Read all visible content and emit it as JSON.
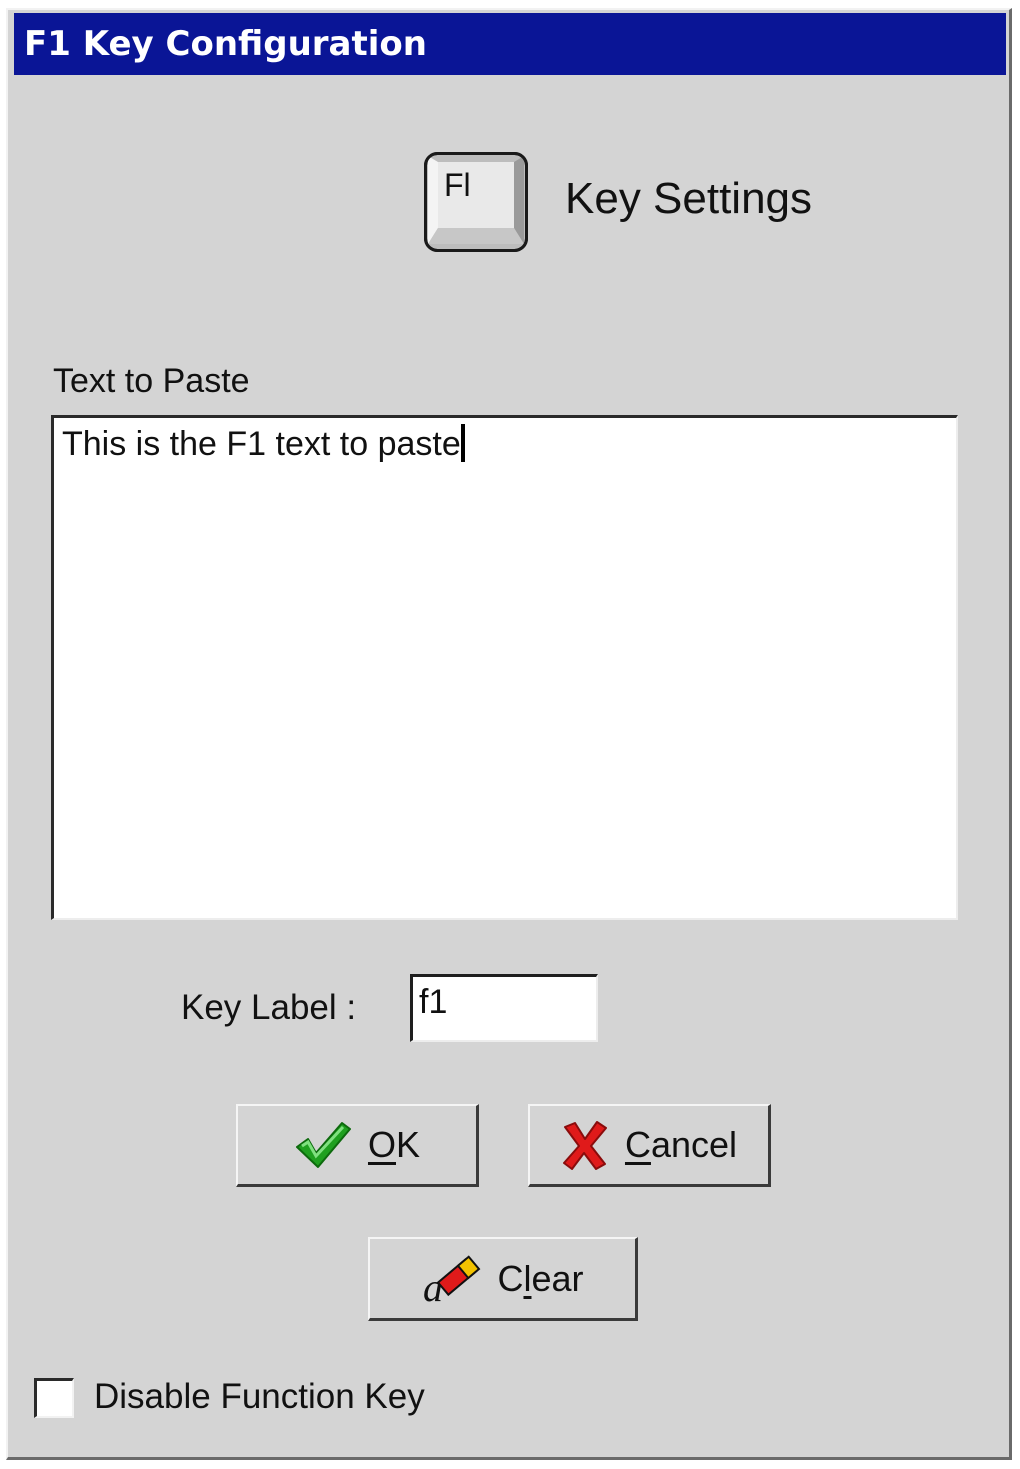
{
  "window": {
    "title": "F1 Key Configuration"
  },
  "header": {
    "keycap_text": "Fl",
    "title": "Key Settings",
    "icon": "f1-keycap-icon"
  },
  "paste": {
    "label": "Text to Paste",
    "value": "This is the F1 text to paste"
  },
  "key_label": {
    "caption": "Key Label :",
    "value": "f1"
  },
  "buttons": {
    "ok": {
      "mnemonic": "O",
      "rest": "K",
      "icon": "checkmark-icon"
    },
    "cancel": {
      "mnemonic": "C",
      "rest": "ancel",
      "icon": "red-x-icon"
    },
    "clear": {
      "prefix": "C",
      "mnemonic": "l",
      "rest": "ear",
      "icon": "eraser-icon"
    }
  },
  "options": {
    "disable_label": "Disable Function Key",
    "disable_checked": false
  },
  "colors": {
    "titlebar": "#0a1596",
    "dialog_bg": "#d4d4d4",
    "ok_check": "#1fa01f",
    "cancel_x": "#e01a1a"
  }
}
